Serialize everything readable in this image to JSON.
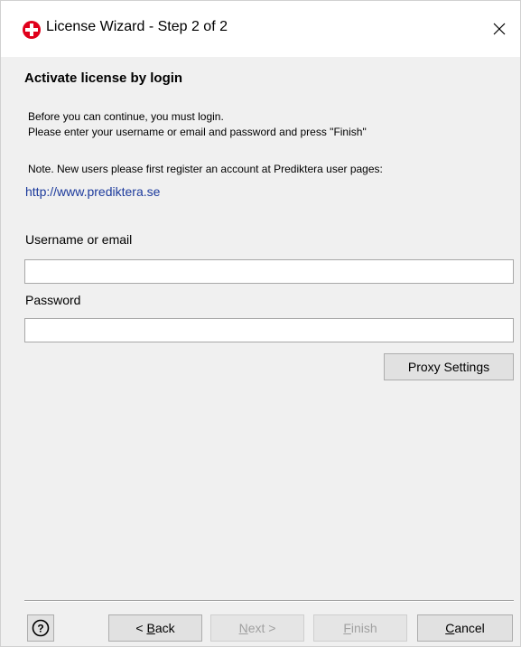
{
  "window": {
    "title": "License Wizard - Step 2 of 2",
    "close_symbol": "×"
  },
  "content": {
    "heading": "Activate license by login",
    "intro_line1": "Before you can continue, you must login.",
    "intro_line2": "Please enter your username or email and password and press \"Finish\"",
    "note": "Note. New users please first register an account at Prediktera user pages:",
    "link": "http://www.prediktera.se"
  },
  "form": {
    "username_label": "Username or email",
    "username_value": "",
    "password_label": "Password",
    "password_value": "",
    "proxy_button": "Proxy Settings"
  },
  "footer": {
    "help_symbol": "?",
    "back": {
      "prefix": "< ",
      "accel": "B",
      "rest": "ack"
    },
    "next": {
      "accel": "N",
      "rest": "ext >"
    },
    "finish": {
      "accel": "F",
      "rest": "inish"
    },
    "cancel": {
      "accel": "C",
      "rest": "ancel"
    }
  },
  "colors": {
    "link": "#1c3a9c",
    "app_icon": "#e0001b",
    "window_bg": "#f0f0f0",
    "disabled_text": "#a0a0a0"
  },
  "icons": {
    "app": "prediktera-logo-icon",
    "close": "close-icon",
    "help": "help-icon"
  }
}
